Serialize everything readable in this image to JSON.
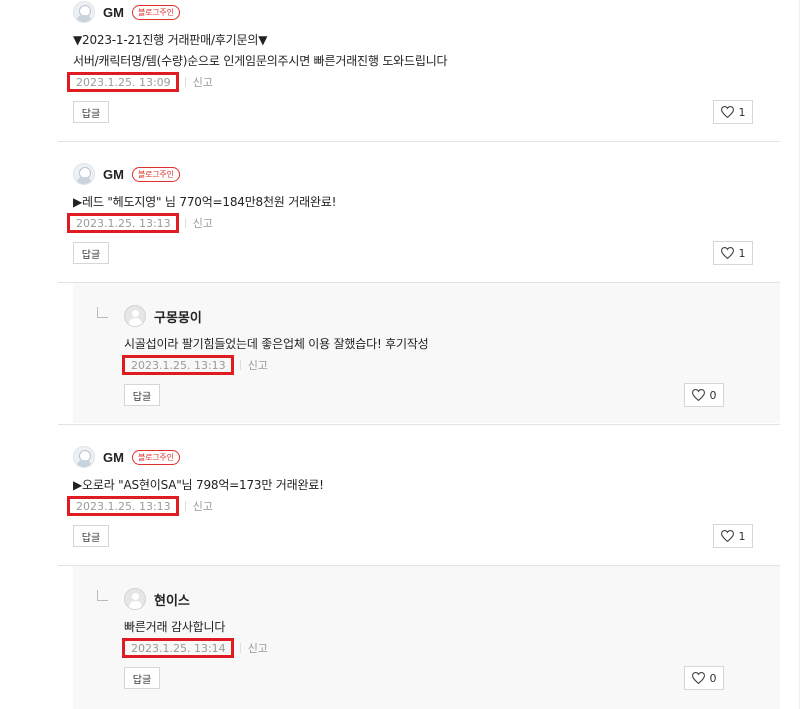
{
  "comments": [
    {
      "nick": "GM",
      "badge": "블로그주인",
      "lines": [
        "▼2023-1-21진행 거래판매/후기문의▼",
        "서버/캐릭터명/템(수량)순으로 인게임문의주시면 빠른거래진행 도와드립니다"
      ],
      "date": "2023.1.25. 13:09",
      "report": "신고",
      "reply": "답글",
      "likes": "1"
    },
    {
      "nick": "GM",
      "badge": "블로그주인",
      "lines": [
        "▶레드 \"헤도지영\" 님 770억=184만8천원 거래완료!"
      ],
      "date": "2023.1.25. 13:13",
      "report": "신고",
      "reply": "답글",
      "likes": "1"
    },
    {
      "nick": "구몽몽이",
      "lines": [
        "시골섭이라 팔기힘들었는데 좋은업체 이용 잘했습다! 후기작성"
      ],
      "date": "2023.1.25. 13:13",
      "report": "신고",
      "reply": "답글",
      "likes": "0"
    },
    {
      "nick": "GM",
      "badge": "블로그주인",
      "lines": [
        "▶오로라 \"AS현이SA\"님 798억=173만 거래완료!"
      ],
      "date": "2023.1.25. 13:13",
      "report": "신고",
      "reply": "답글",
      "likes": "1"
    },
    {
      "nick": "현이스",
      "lines": [
        "빠른거래 감사합니다"
      ],
      "date": "2023.1.25. 13:14",
      "report": "신고",
      "reply": "답글",
      "likes": "0"
    }
  ],
  "colors": {
    "highlight": "#e01b22",
    "badge": "#e0302d",
    "reply_bg": "#f8f8f8"
  },
  "icons": {
    "gm_avatar": "gm-avatar-icon",
    "user_avatar": "default-avatar-icon",
    "like": "heart-icon",
    "reply_arrow": "reply-arrow-icon"
  }
}
